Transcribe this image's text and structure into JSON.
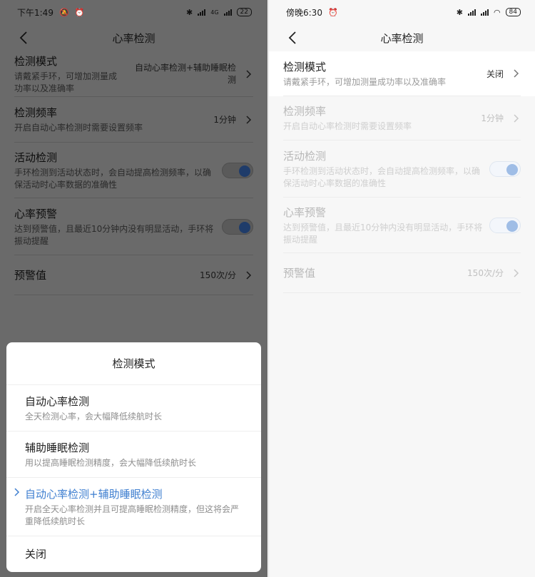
{
  "left": {
    "status": {
      "time": "下午1:49",
      "net": "4G",
      "battery": "22"
    },
    "nav": {
      "title": "心率检测"
    },
    "rows": [
      {
        "title": "检测模式",
        "desc": "请戴紧手环，可增加测量成功率以及准确率",
        "value": "自动心率检测+辅助睡眠检测"
      },
      {
        "title": "检测频率",
        "desc": "开启自动心率检测时需要设置频率",
        "value": "1分钟"
      },
      {
        "title": "活动检测",
        "desc": "手环检测到活动状态时，会自动提高检测频率，以确保活动时心率数据的准确性"
      },
      {
        "title": "心率预警",
        "desc": "达到预警值，且最近10分钟内没有明显活动，手环将振动提醒"
      },
      {
        "title": "预警值",
        "value": "150次/分"
      }
    ],
    "sheet": {
      "title": "检测模式",
      "options": [
        {
          "title": "自动心率检测",
          "desc": "全天检测心率，会大幅降低续航时长"
        },
        {
          "title": "辅助睡眠检测",
          "desc": "用以提高睡眠检测精度，会大幅降低续航时长"
        },
        {
          "title": "自动心率检测+辅助睡眠检测",
          "desc": "开启全天心率检测并且可提高睡眠检测精度，但这将会严重降低续航时长"
        },
        {
          "title": "关闭"
        }
      ]
    }
  },
  "right": {
    "status": {
      "time": "傍晚6:30",
      "battery": "84"
    },
    "nav": {
      "title": "心率检测"
    },
    "rows": [
      {
        "title": "检测模式",
        "desc": "请戴紧手环，可增加测量成功率以及准确率",
        "value": "关闭"
      },
      {
        "title": "检测频率",
        "desc": "开启自动心率检测时需要设置频率",
        "value": "1分钟"
      },
      {
        "title": "活动检测",
        "desc": "手环检测到活动状态时，会自动提高检测频率，以确保活动时心率数据的准确性"
      },
      {
        "title": "心率预警",
        "desc": "达到预警值，且最近10分钟内没有明显活动，手环将振动提醒"
      },
      {
        "title": "预警值",
        "value": "150次/分"
      }
    ]
  }
}
